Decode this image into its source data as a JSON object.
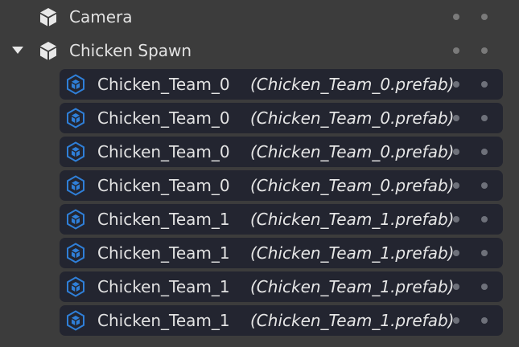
{
  "hierarchy": {
    "nodes": [
      {
        "label": "Camera",
        "icon": "cube-icon",
        "expandable": false
      },
      {
        "label": "Chicken Spawn",
        "icon": "cube-icon",
        "expandable": true,
        "expanded": true
      }
    ],
    "children": [
      {
        "label": "Chicken_Team_0",
        "ref": "(Chicken_Team_0.prefab)",
        "icon": "prefab-icon"
      },
      {
        "label": "Chicken_Team_0",
        "ref": "(Chicken_Team_0.prefab)",
        "icon": "prefab-icon"
      },
      {
        "label": "Chicken_Team_0",
        "ref": "(Chicken_Team_0.prefab)",
        "icon": "prefab-icon"
      },
      {
        "label": "Chicken_Team_0",
        "ref": "(Chicken_Team_0.prefab)",
        "icon": "prefab-icon"
      },
      {
        "label": "Chicken_Team_1",
        "ref": "(Chicken_Team_1.prefab)",
        "icon": "prefab-icon"
      },
      {
        "label": "Chicken_Team_1",
        "ref": "(Chicken_Team_1.prefab)",
        "icon": "prefab-icon"
      },
      {
        "label": "Chicken_Team_1",
        "ref": "(Chicken_Team_1.prefab)",
        "icon": "prefab-icon"
      },
      {
        "label": "Chicken_Team_1",
        "ref": "(Chicken_Team_1.prefab)",
        "icon": "prefab-icon"
      }
    ]
  },
  "colors": {
    "background": "#3c3c3c",
    "prefab_row": "#232530",
    "prefab_icon": "#2f7fd8",
    "text": "#e3e3e3"
  }
}
